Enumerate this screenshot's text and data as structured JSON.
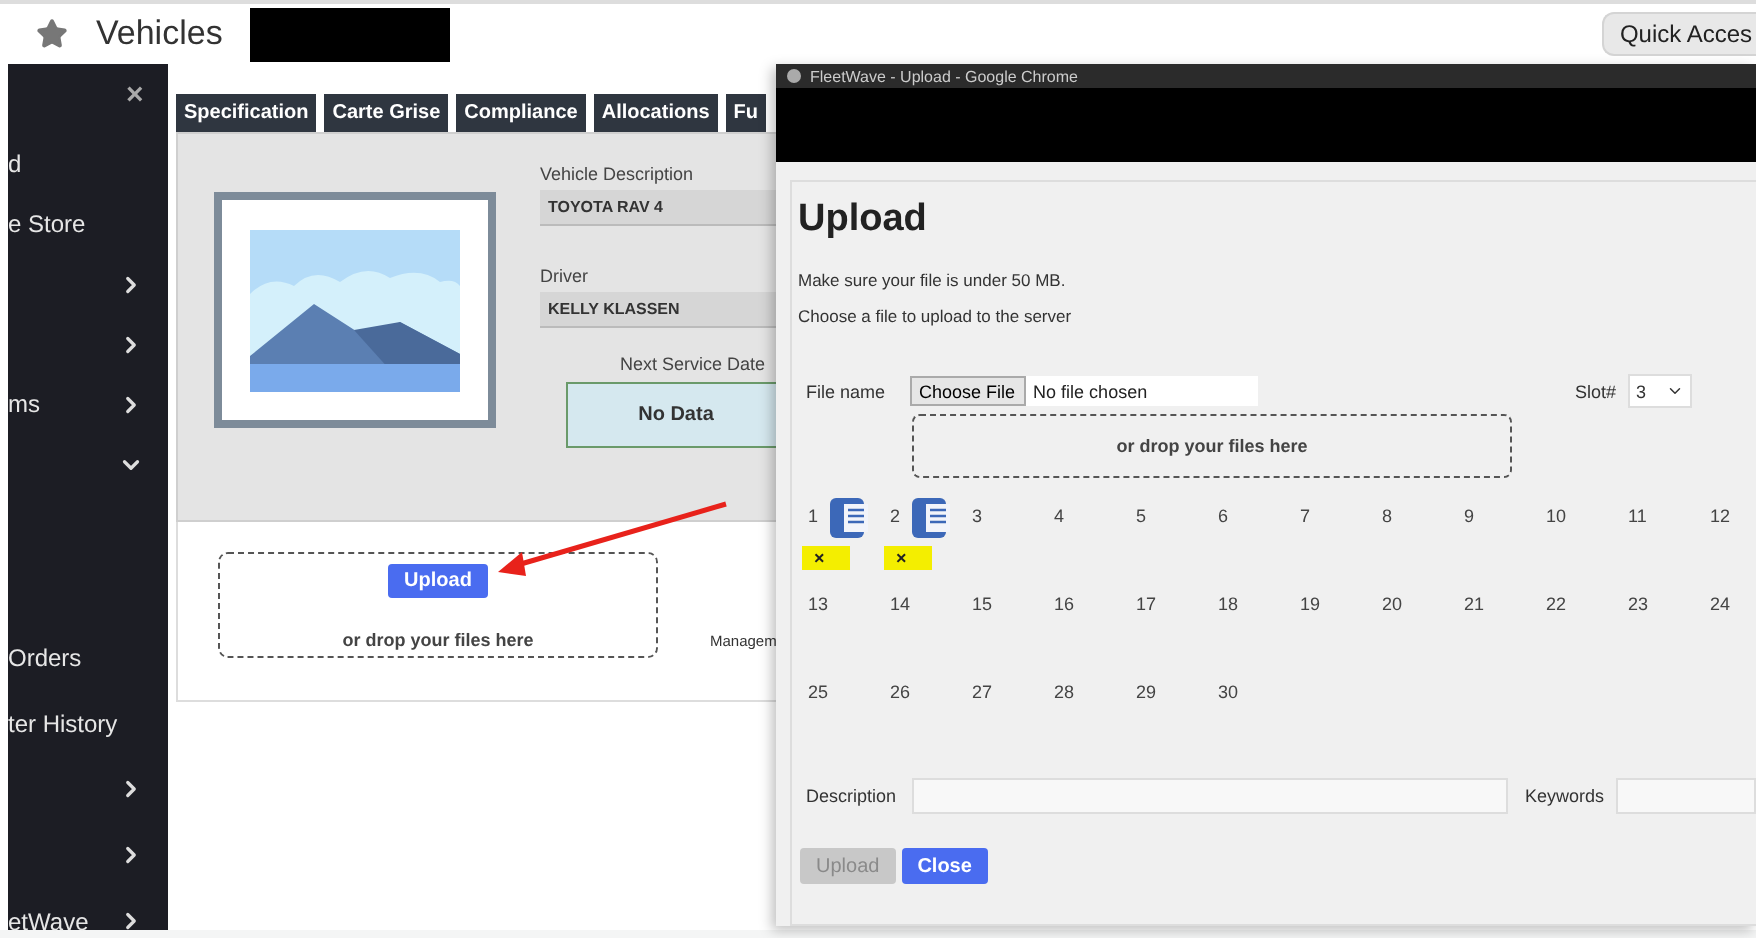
{
  "top_bar": {
    "title": "Vehicles",
    "quick_access": "Quick Acces"
  },
  "sidebar": {
    "close": "×",
    "items": [
      {
        "label": "d"
      },
      {
        "label": "e Store"
      },
      {
        "expanded": false
      },
      {
        "expanded": false
      },
      {
        "label": "ms",
        "expanded": false
      },
      {
        "expanded": true
      },
      {
        "label": "Orders"
      },
      {
        "label": "ter History"
      },
      {
        "expanded": false
      },
      {
        "expanded": false
      },
      {
        "label": "etWave",
        "expanded": false
      }
    ]
  },
  "tabs": [
    {
      "label": "Specification"
    },
    {
      "label": "Carte Grise"
    },
    {
      "label": "Compliance"
    },
    {
      "label": "Allocations"
    },
    {
      "label": "Fu"
    }
  ],
  "vehicle": {
    "fields": [
      {
        "label": "Vehicle Description",
        "value": "TOYOTA RAV 4"
      },
      {
        "label": "Driver",
        "value": "KELLY KLASSEN"
      }
    ],
    "next_service": {
      "label": "Next Service Date",
      "value": "No Data"
    }
  },
  "upload_zone": {
    "button": "Upload",
    "hint": "or drop your files here"
  },
  "cut_label": "Managem",
  "popup": {
    "window_title": "FleetWave - Upload - Google Chrome",
    "heading": "Upload",
    "notes": [
      "Make sure your file is under 50 MB.",
      "Choose a file to upload to the server"
    ],
    "file_label": "File name",
    "choose_button": "Choose File",
    "file_status": "No file chosen",
    "slot_label": "Slot#",
    "slot_value": "3",
    "drop_hint": "or drop your files here",
    "slots": [
      {
        "number": "1",
        "has_file": true,
        "remove": "×"
      },
      {
        "number": "2",
        "has_file": true,
        "remove": "×"
      },
      {
        "number": "3",
        "has_file": false
      },
      {
        "number": "4",
        "has_file": false
      },
      {
        "number": "5",
        "has_file": false
      },
      {
        "number": "6",
        "has_file": false
      },
      {
        "number": "7",
        "has_file": false
      },
      {
        "number": "8",
        "has_file": false
      },
      {
        "number": "9",
        "has_file": false
      },
      {
        "number": "10",
        "has_file": false
      },
      {
        "number": "11",
        "has_file": false
      },
      {
        "number": "12",
        "has_file": false
      },
      {
        "number": "13",
        "has_file": false
      },
      {
        "number": "14",
        "has_file": false
      },
      {
        "number": "15",
        "has_file": false
      },
      {
        "number": "16",
        "has_file": false
      },
      {
        "number": "17",
        "has_file": false
      },
      {
        "number": "18",
        "has_file": false
      },
      {
        "number": "19",
        "has_file": false
      },
      {
        "number": "20",
        "has_file": false
      },
      {
        "number": "21",
        "has_file": false
      },
      {
        "number": "22",
        "has_file": false
      },
      {
        "number": "23",
        "has_file": false
      },
      {
        "number": "24",
        "has_file": false
      },
      {
        "number": "25",
        "has_file": false
      },
      {
        "number": "26",
        "has_file": false
      },
      {
        "number": "27",
        "has_file": false
      },
      {
        "number": "28",
        "has_file": false
      },
      {
        "number": "29",
        "has_file": false
      },
      {
        "number": "30",
        "has_file": false
      }
    ],
    "description_label": "Description",
    "keywords_label": "Keywords",
    "buttons": [
      {
        "label": "Upload",
        "disabled": true
      },
      {
        "label": "Close",
        "disabled": false
      }
    ]
  }
}
